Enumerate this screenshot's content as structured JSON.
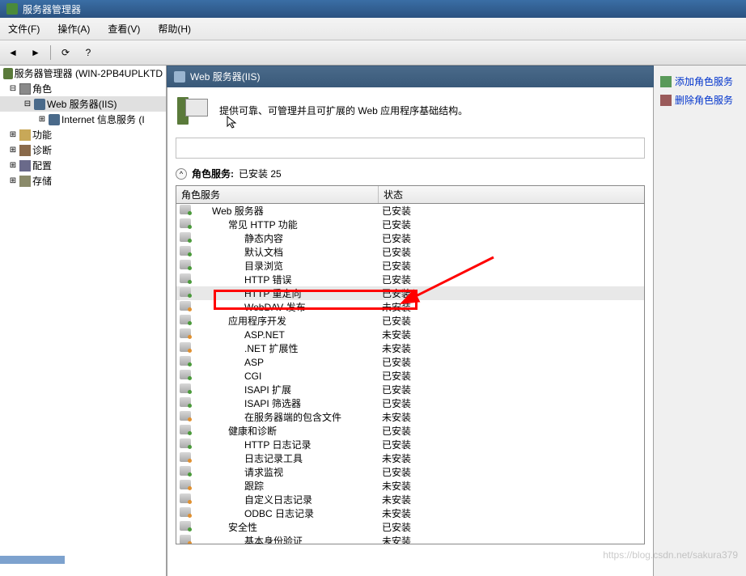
{
  "title": "服务器管理器",
  "menu": {
    "file": "文件(F)",
    "action": "操作(A)",
    "view": "查看(V)",
    "help": "帮助(H)"
  },
  "tree": {
    "root": "服务器管理器 (WIN-2PB4UPLKTD",
    "roles": "角色",
    "web_iis": "Web 服务器(IIS)",
    "internet_service": "Internet 信息服务 (I",
    "features": "功能",
    "diagnostics": "诊断",
    "configuration": "配置",
    "storage": "存储"
  },
  "content": {
    "header": "Web 服务器(IIS)",
    "description": "提供可靠、可管理并且可扩展的 Web 应用程序基础结构。"
  },
  "section": {
    "role_services": "角色服务:",
    "installed_count": "已安装 25"
  },
  "table": {
    "header_name": "角色服务",
    "header_state": "状态"
  },
  "status": {
    "installed": "已安装",
    "not_installed": "未安装"
  },
  "services": [
    {
      "name": "Web 服务器",
      "indent": 0,
      "installed": true
    },
    {
      "name": "常见 HTTP 功能",
      "indent": 1,
      "installed": true
    },
    {
      "name": "静态内容",
      "indent": 2,
      "installed": true
    },
    {
      "name": "默认文档",
      "indent": 2,
      "installed": true
    },
    {
      "name": "目录浏览",
      "indent": 2,
      "installed": true
    },
    {
      "name": "HTTP 错误",
      "indent": 2,
      "installed": true
    },
    {
      "name": "HTTP 重定向",
      "indent": 2,
      "installed": true,
      "highlighted": true
    },
    {
      "name": "WebDAV 发布",
      "indent": 2,
      "installed": false
    },
    {
      "name": "应用程序开发",
      "indent": 1,
      "installed": true
    },
    {
      "name": "ASP.NET",
      "indent": 2,
      "installed": false
    },
    {
      "name": ".NET 扩展性",
      "indent": 2,
      "installed": false
    },
    {
      "name": "ASP",
      "indent": 2,
      "installed": true
    },
    {
      "name": "CGI",
      "indent": 2,
      "installed": true
    },
    {
      "name": "ISAPI 扩展",
      "indent": 2,
      "installed": true
    },
    {
      "name": "ISAPI 筛选器",
      "indent": 2,
      "installed": true
    },
    {
      "name": "在服务器端的包含文件",
      "indent": 2,
      "installed": false
    },
    {
      "name": "健康和诊断",
      "indent": 1,
      "installed": true
    },
    {
      "name": "HTTP 日志记录",
      "indent": 2,
      "installed": true
    },
    {
      "name": "日志记录工具",
      "indent": 2,
      "installed": false
    },
    {
      "name": "请求监视",
      "indent": 2,
      "installed": true
    },
    {
      "name": "跟踪",
      "indent": 2,
      "installed": false
    },
    {
      "name": "自定义日志记录",
      "indent": 2,
      "installed": false
    },
    {
      "name": "ODBC 日志记录",
      "indent": 2,
      "installed": false
    },
    {
      "name": "安全性",
      "indent": 1,
      "installed": true
    },
    {
      "name": "基本身份验证",
      "indent": 2,
      "installed": false
    }
  ],
  "actions": {
    "add": "添加角色服务",
    "remove": "删除角色服务"
  },
  "watermark": "https://blog.csdn.net/sakura379"
}
